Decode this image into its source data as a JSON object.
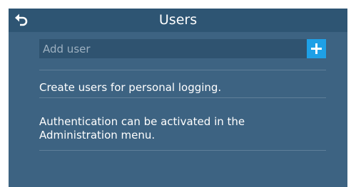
{
  "header": {
    "title": "Users",
    "back_icon": "back-arrow-icon"
  },
  "add_user": {
    "placeholder": "Add user",
    "value": "",
    "button_icon": "plus-icon"
  },
  "info": {
    "line1": "Create users for personal logging.",
    "line2": "Authentication can be activated in the Administration menu."
  },
  "colors": {
    "background": "#3d6382",
    "titlebar": "#2e5573",
    "input_background": "#2f5370",
    "accent": "#1ea0e6",
    "divider": "#5f7f99",
    "text": "#ffffff"
  }
}
